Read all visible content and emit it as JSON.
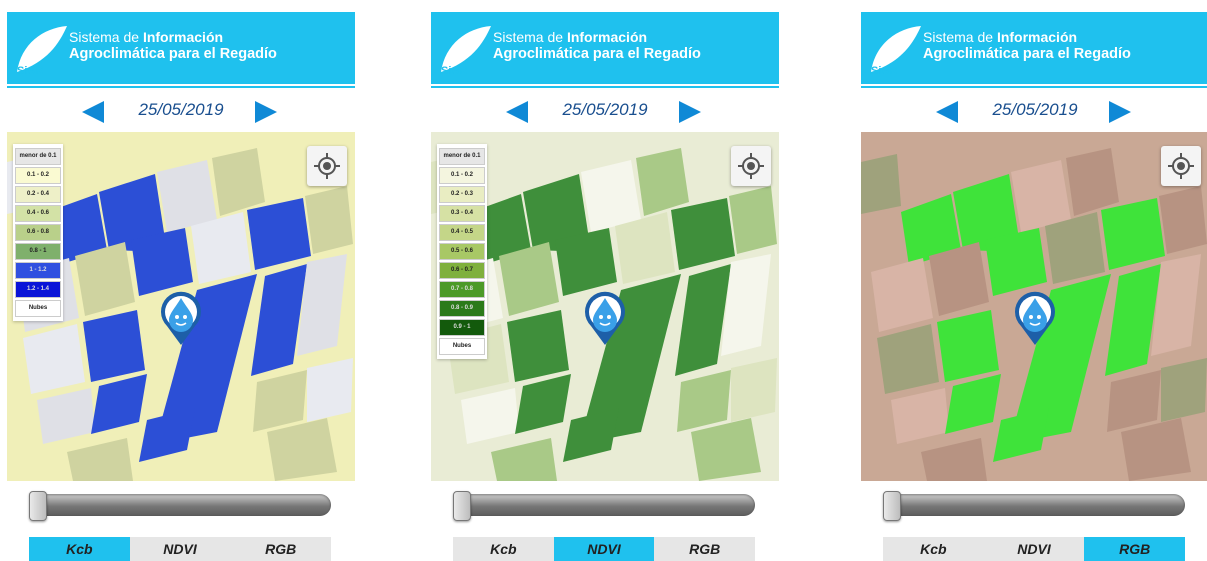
{
  "app": {
    "title_line1_pre": "Sistema de ",
    "title_line1_bold": "Información",
    "title_line2": "Agroclimática para el Regadío",
    "logo_text": "SiAR"
  },
  "colors": {
    "header": "#1fc1ee",
    "arrow": "#0f89d6",
    "date": "#1a4f8f",
    "active_tab": "#1fc1ee"
  },
  "panels": [
    {
      "date": "25/05/2019",
      "active_tab": "Kcb",
      "slider_value": 0,
      "legend": [
        {
          "label": "menor de 0.1",
          "color": "#e6e6e6"
        },
        {
          "label": "0.1 - 0.2",
          "color": "#fafad2"
        },
        {
          "label": "0.2 - 0.4",
          "color": "#eef0c8"
        },
        {
          "label": "0.4 - 0.6",
          "color": "#d3e2a6"
        },
        {
          "label": "0.6 - 0.8",
          "color": "#b9d08a"
        },
        {
          "label": "0.8 - 1",
          "color": "#7fb06c"
        },
        {
          "label": "1 - 1.2",
          "color": "#3050e0"
        },
        {
          "label": "1.2 - 1.4",
          "color": "#0a14d8"
        },
        {
          "label": "Nubes",
          "color": "#ffffff"
        }
      ],
      "tabs": [
        "Kcb",
        "NDVI",
        "RGB"
      ]
    },
    {
      "date": "25/05/2019",
      "active_tab": "NDVI",
      "slider_value": 0,
      "legend": [
        {
          "label": "menor de 0.1",
          "color": "#e6e6e6"
        },
        {
          "label": "0.1 - 0.2",
          "color": "#f4f5df"
        },
        {
          "label": "0.2 - 0.3",
          "color": "#e9edc2"
        },
        {
          "label": "0.3 - 0.4",
          "color": "#d6e1a4"
        },
        {
          "label": "0.4 - 0.5",
          "color": "#c4d688"
        },
        {
          "label": "0.5 - 0.6",
          "color": "#a8c865"
        },
        {
          "label": "0.6 - 0.7",
          "color": "#7fb03d"
        },
        {
          "label": "0.7 - 0.8",
          "color": "#4c9a28"
        },
        {
          "label": "0.8 - 0.9",
          "color": "#2b7a1a"
        },
        {
          "label": "0.9 - 1",
          "color": "#135a0c"
        },
        {
          "label": "Nubes",
          "color": "#ffffff"
        }
      ],
      "tabs": [
        "Kcb",
        "NDVI",
        "RGB"
      ]
    },
    {
      "date": "25/05/2019",
      "active_tab": "RGB",
      "slider_value": 0,
      "legend": [],
      "tabs": [
        "Kcb",
        "NDVI",
        "RGB"
      ]
    }
  ]
}
